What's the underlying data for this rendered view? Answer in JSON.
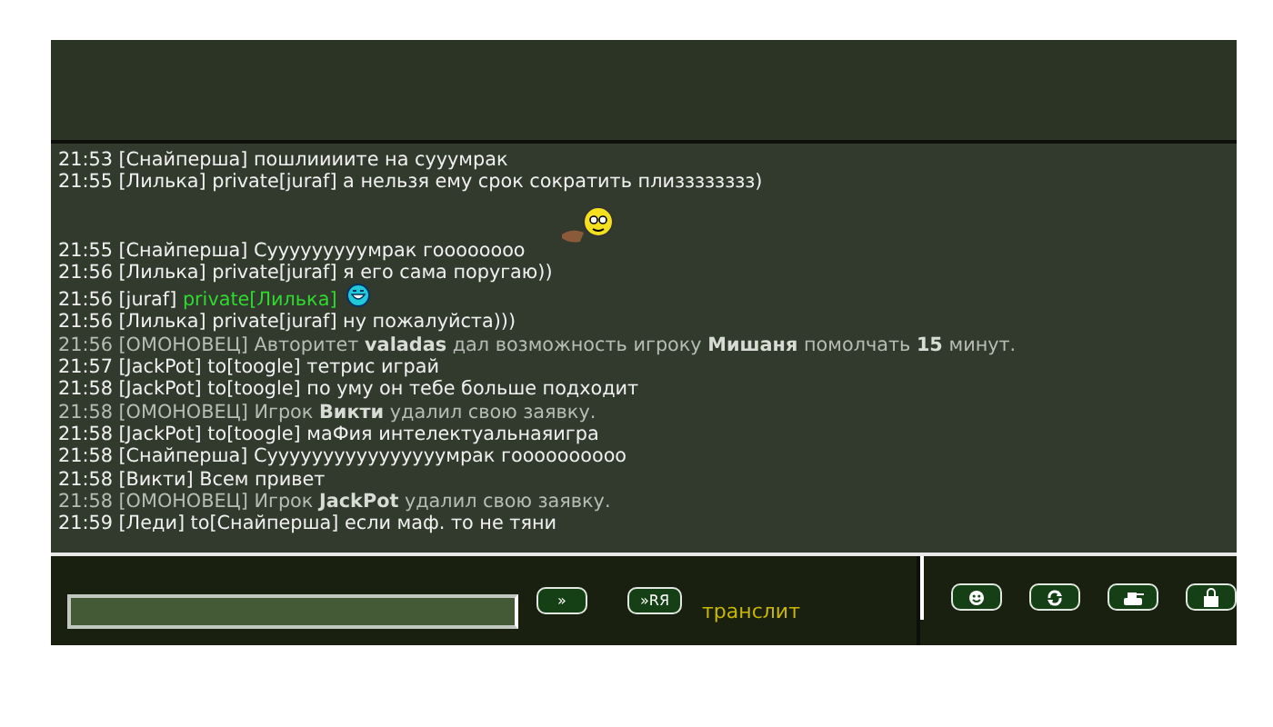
{
  "messages": [
    {
      "time": "21:53",
      "text": "[Снайперша] пошлиииите на сууумрак",
      "kind": "normal"
    },
    {
      "time": "21:55",
      "text": "[Лилька] private[juraf] а нельзя ему срок сократить плизззззззз)",
      "kind": "normal"
    },
    {
      "time": "21:55",
      "text": "[Снайперша] Сууууууууумрак гоооооооо",
      "kind": "normal",
      "pipe_smiley": true
    },
    {
      "time": "21:56",
      "text": "[Лилька] private[juraf] я его сама поругаю))",
      "kind": "normal"
    },
    {
      "time": "21:56",
      "text": "[juraf]",
      "private": "private[Лилька]",
      "kind": "normal",
      "grin_smiley": true
    },
    {
      "time": "21:56",
      "text": "[Лилька] private[juraf] ну пожалуйста)))",
      "kind": "normal"
    },
    {
      "time": "21:56",
      "text": "[ОМОНОВЕЦ] Авторитет **valadas** дал возможность игроку **Мишаня** помолчать **15** минут.",
      "kind": "system"
    },
    {
      "time": "21:57",
      "text": "[JackPot] to[toogle] тетрис играй",
      "kind": "normal"
    },
    {
      "time": "21:58",
      "text": "[JackPot] to[toogle] по уму он тебе больше подходит",
      "kind": "normal"
    },
    {
      "time": "21:58",
      "text": "[ОМОНОВЕЦ] Игрок **Викти** удалил свою заявку.",
      "kind": "system"
    },
    {
      "time": "21:58",
      "text": "[JackPot] to[toogle] маФия интелектуальнаяигра",
      "kind": "normal"
    },
    {
      "time": "21:58",
      "text": "[Снайперша] Суууууууууууууууумрак гоооооооооо",
      "kind": "normal"
    },
    {
      "time": "21:58",
      "text": "[Викти] Всем привет",
      "kind": "normal"
    },
    {
      "time": "21:58",
      "text": "[ОМОНОВЕЦ] Игрок **JackPot** удалил свою заявку.",
      "kind": "system"
    },
    {
      "time": "21:59",
      "text": "[Леди] to[Снайперша] если маф. то не тяни",
      "kind": "normal"
    }
  ],
  "send_buttons": [
    "»",
    "»RЯ"
  ],
  "translit": "транслит",
  "tools": [
    {
      "kind": "smiley"
    },
    {
      "kind": "refresh"
    },
    {
      "kind": "tank"
    },
    {
      "kind": "lock"
    }
  ]
}
